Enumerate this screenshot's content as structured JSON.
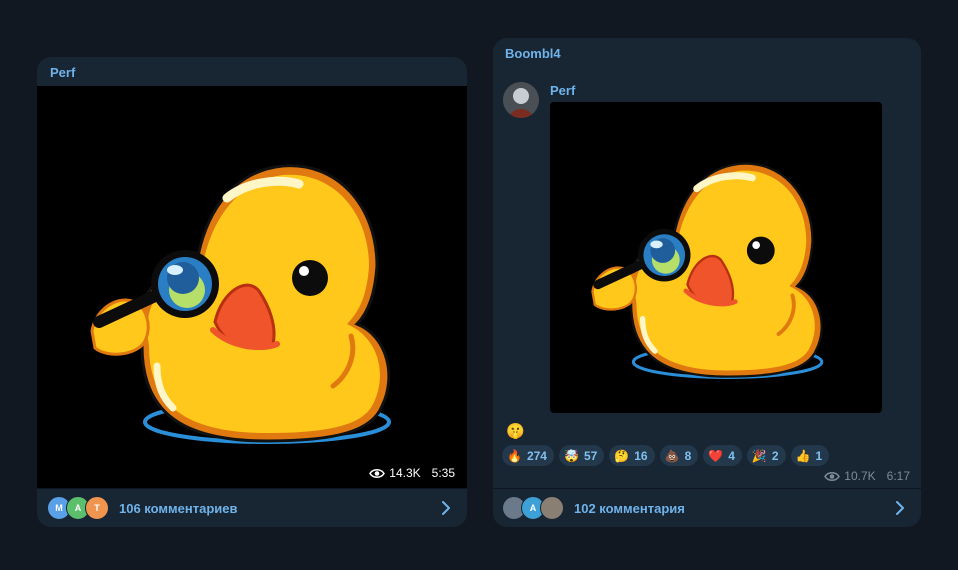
{
  "post1": {
    "author": "Perf",
    "views": "14.3K",
    "time": "5:35",
    "comments": {
      "label": "106 комментариев",
      "avatars": [
        {
          "letter": "M",
          "color": "#5aa0e6"
        },
        {
          "letter": "A",
          "color": "#5cbf6b"
        },
        {
          "letter": "T",
          "color": "#f0954f"
        }
      ]
    }
  },
  "post2": {
    "forwarded_from": "Boombl4",
    "author": "Perf",
    "single_reaction": "🤫",
    "reactions": [
      {
        "emoji": "🔥",
        "count": "274"
      },
      {
        "emoji": "🤯",
        "count": "57"
      },
      {
        "emoji": "🤔",
        "count": "16"
      },
      {
        "emoji": "💩",
        "count": "8"
      },
      {
        "emoji": "❤️",
        "count": "4"
      },
      {
        "emoji": "🎉",
        "count": "2"
      },
      {
        "emoji": "👍",
        "count": "1"
      }
    ],
    "views": "10.7K",
    "time": "6:17",
    "comments": {
      "label": "102 комментария",
      "avatars": [
        {
          "letter": "",
          "color": "#6b7a8a"
        },
        {
          "letter": "A",
          "color": "#3da0d6"
        },
        {
          "letter": "",
          "color": "#8a7f73"
        }
      ]
    }
  },
  "icons": {
    "views": "eye-icon",
    "open_comments": "chevron-right-icon"
  },
  "colors": {
    "background": "#111822",
    "bubble": "#182533",
    "accent": "#6fb3ea",
    "duck_yellow": "#ffc81a",
    "beak": "#f0542a"
  }
}
